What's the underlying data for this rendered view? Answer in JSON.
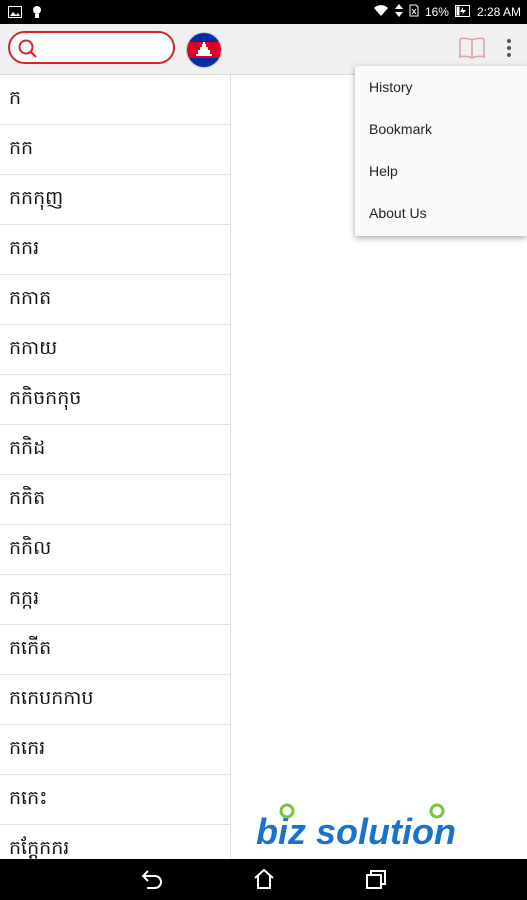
{
  "status_bar": {
    "battery_percent": "16%",
    "time": "2:28 AM"
  },
  "toolbar": {
    "search_placeholder": "",
    "search_value": ""
  },
  "word_list": {
    "items": [
      "ក",
      "កក",
      "កកកុញ",
      "កករ",
      "កកាត",
      "កកាយ",
      "កកិចកកុច",
      "កកិដ",
      "កកិត",
      "កកិល",
      "កក្ករ",
      "កកើត",
      "កកេបកកាប",
      "កកេរ",
      "កកេះ",
      "កក្តែកករ"
    ]
  },
  "menu": {
    "items": [
      "History",
      "Bookmark",
      "Help",
      "About Us"
    ]
  },
  "logo": {
    "text": "biz solution"
  },
  "colors": {
    "accent_red": "#d8232a",
    "logo_blue": "#1a73c9",
    "logo_green": "#7dc242"
  }
}
